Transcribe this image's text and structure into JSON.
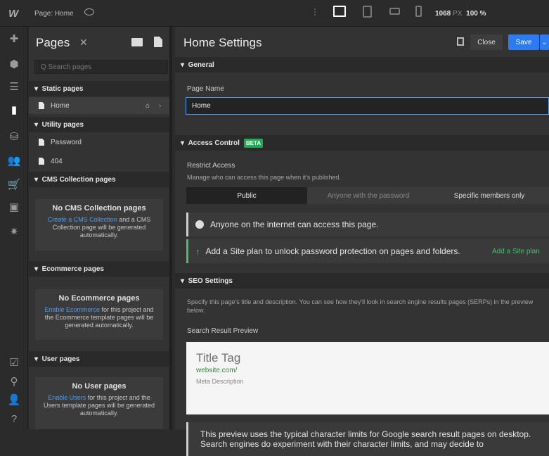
{
  "topbar": {
    "logo": "W",
    "page_label": "Page: Home",
    "width_px": "1068",
    "px_unit": "PX",
    "zoom": "100 %"
  },
  "pages_panel": {
    "title": "Pages",
    "search_placeholder": "Q Search pages",
    "static_header": "Static pages",
    "home": "Home",
    "utility_header": "Utility pages",
    "password": "Password",
    "p404": "404",
    "cms_header": "CMS Collection pages",
    "cms_empty_title": "No CMS Collection pages",
    "cms_link": "Create a CMS Collection",
    "cms_rest": " and a CMS Collection page will be generated automatically.",
    "ecom_header": "Ecommerce pages",
    "ecom_empty_title": "No Ecommerce pages",
    "ecom_link": "Enable Ecommerce",
    "ecom_rest": " for this project and the Ecommerce template pages will be generated automatically.",
    "user_header": "User pages",
    "user_empty_title": "No User pages",
    "user_link": "Enable Users",
    "user_rest": " for this project and the Users template pages will be generated automatically."
  },
  "settings": {
    "title": "Home Settings",
    "close": "Close",
    "save": "Save",
    "general": "General",
    "page_name_label": "Page Name",
    "page_name_value": "Home",
    "access_control": "Access Control",
    "beta": "BETA",
    "restrict_label": "Restrict Access",
    "restrict_desc": "Manage who can access this page when it's published.",
    "seg_public": "Public",
    "seg_password": "Anyone with the password",
    "seg_members": "Specific members only",
    "notice_public": "Anyone on the internet can access this page.",
    "notice_plan": "Add a Site plan to unlock password protection on pages and folders.",
    "notice_plan_link": "Add a Site plan",
    "seo": "SEO Settings",
    "seo_desc": "Specify this page's title and description. You can see how they'll look in search engine results pages (SERPs) in the preview below.",
    "search_preview_label": "Search Result Preview",
    "preview_title": "Title Tag",
    "preview_url": "website.com/",
    "preview_meta": "Meta Description",
    "preview_note": "This preview uses the typical character limits for Google search result pages on desktop. Search engines do experiment with their character limits, and may decide to"
  },
  "colors": {
    "accent": "#4a9df0",
    "save_btn": "#2d7bf2",
    "beta": "#1faa55",
    "success": "#3fc26b"
  }
}
